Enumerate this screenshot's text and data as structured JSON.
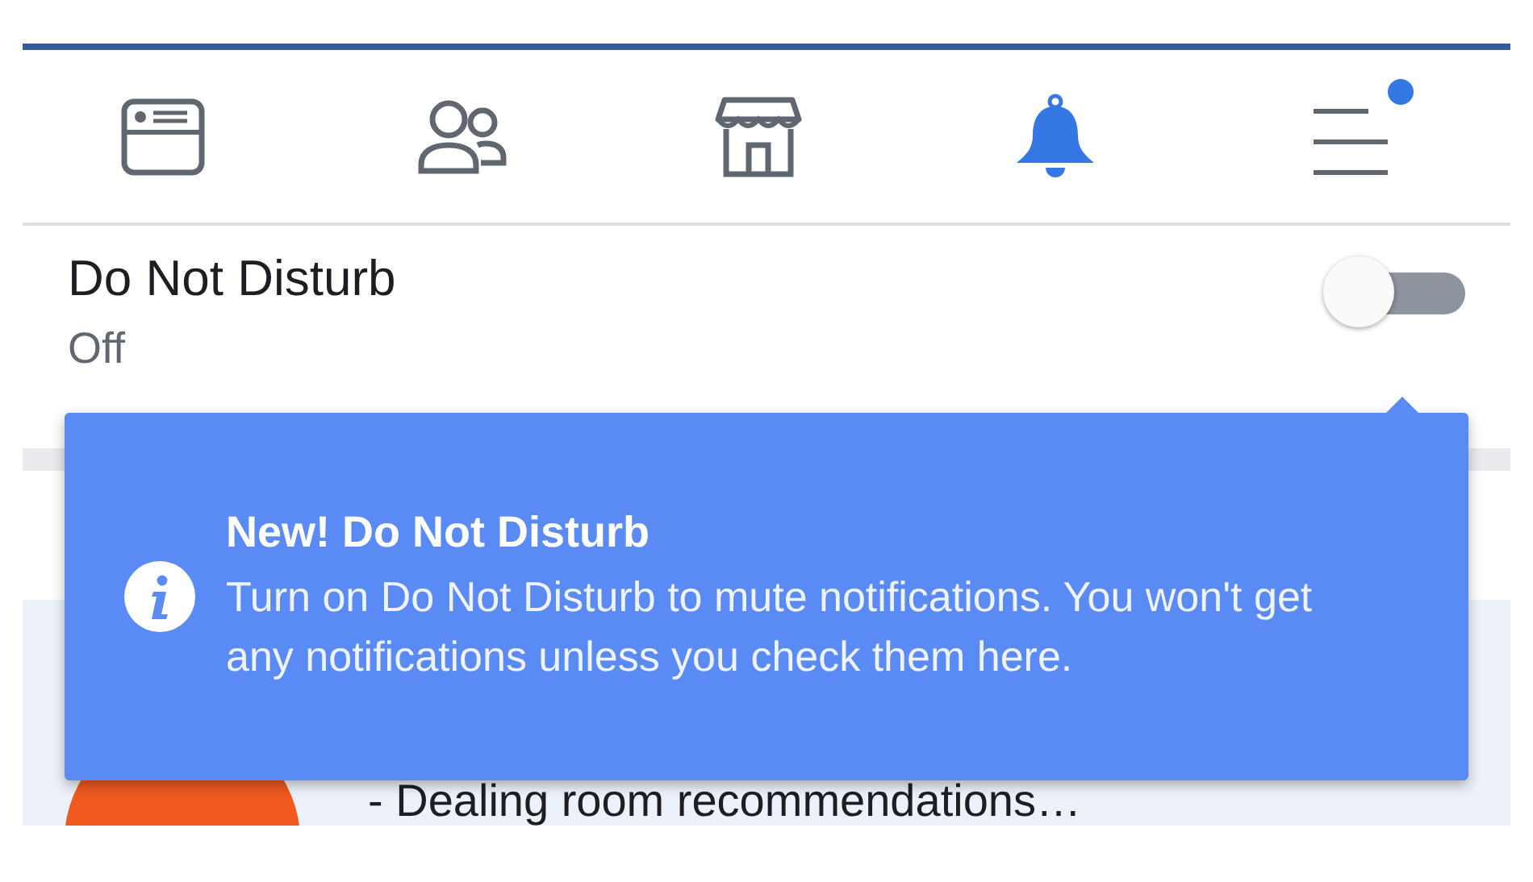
{
  "tabs": [
    {
      "kind": "feed",
      "selected": false,
      "dot": false
    },
    {
      "kind": "friends",
      "selected": false,
      "dot": false
    },
    {
      "kind": "marketplace",
      "selected": false,
      "dot": false
    },
    {
      "kind": "notifications",
      "selected": true,
      "dot": false
    },
    {
      "kind": "menu",
      "selected": false,
      "dot": true
    }
  ],
  "do_not_disturb": {
    "title": "Do Not Disturb",
    "status": "Off",
    "on": false
  },
  "tooltip": {
    "title": "New! Do Not Disturb",
    "text": "Turn on Do Not Disturb to mute notifications. You won't get any notifications unless you check them here."
  },
  "notification": {
    "text": "- Dealing room recommendations…"
  }
}
